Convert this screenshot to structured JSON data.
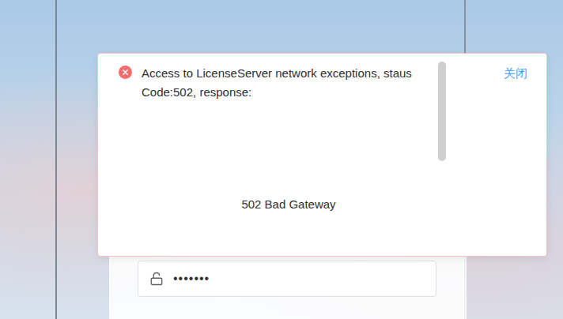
{
  "message": {
    "text": "Access to LicenseServer network exceptions, staus Code:502, response:",
    "body": "502 Bad Gateway",
    "close": "关闭"
  },
  "password": {
    "value": "•••••••"
  }
}
